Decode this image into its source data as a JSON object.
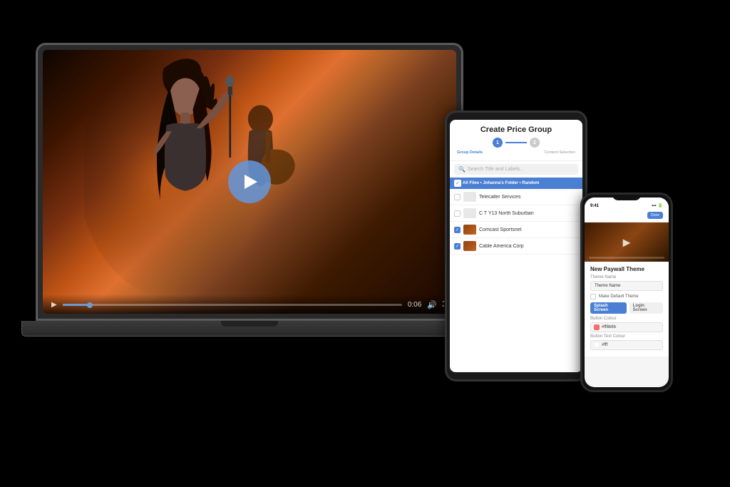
{
  "scene": {
    "background": "#000000"
  },
  "laptop": {
    "video": {
      "play_button_label": "Play",
      "time_current": "0:06",
      "time_total": "0:06"
    },
    "controls": {
      "play_label": "▶",
      "volume_label": "🔊",
      "fullscreen_label": "⛶",
      "time": "0:06"
    }
  },
  "tablet": {
    "title": "Create Price Group",
    "steps": [
      {
        "id": 1,
        "label": "Group Details",
        "active": true
      },
      {
        "id": 2,
        "label": "Content Selection",
        "active": false
      }
    ],
    "search_placeholder": "Search Title and Labels...",
    "breadcrumb": "All Files > Johanna's Folder > Random",
    "files": [
      {
        "name": "Telecaller Services",
        "checked": false,
        "type": "folder"
      },
      {
        "name": "C T Y13 North Suburban",
        "checked": false,
        "type": "folder"
      },
      {
        "name": "Comcast Sportsnet",
        "checked": true,
        "type": "video"
      },
      {
        "name": "Cable America Corp",
        "checked": true,
        "type": "video"
      }
    ]
  },
  "phone": {
    "status_time": "9:41",
    "header_button": "Done",
    "section_title": "New Paywall Theme",
    "theme_name_label": "Theme Name",
    "theme_name_placeholder": "Theme Name",
    "default_theme_label": "Make Default Theme",
    "tabs": [
      {
        "label": "Splash Screen",
        "active": true
      },
      {
        "label": "Login Screen",
        "active": false
      }
    ],
    "button_colour_label": "Button Colour",
    "button_colour_value": "#ff6b6b",
    "button_text_colour_label": "Button Text Colour",
    "button_text_colour_value": "#fff"
  }
}
